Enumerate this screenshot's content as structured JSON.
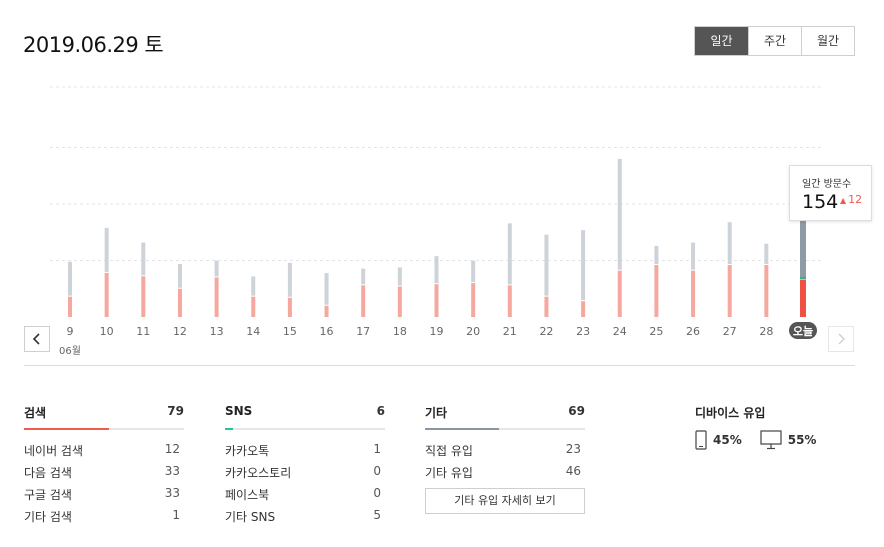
{
  "header": {
    "date": "2019.06.29 토",
    "tabs": [
      "일간",
      "주간",
      "월간"
    ],
    "active_tab": 0
  },
  "chart_data": {
    "type": "bar",
    "month_label": "06월",
    "categories": [
      "9",
      "10",
      "11",
      "12",
      "13",
      "14",
      "15",
      "16",
      "17",
      "18",
      "19",
      "20",
      "21",
      "22",
      "23",
      "24",
      "25",
      "26",
      "27",
      "28",
      "오늘"
    ],
    "series": [
      {
        "values": [
          18,
          39,
          36,
          25,
          35,
          18,
          17,
          10,
          28,
          27,
          29,
          30,
          28,
          18,
          14,
          41,
          46,
          41,
          46,
          46,
          33
        ]
      },
      {
        "values": [
          30,
          39,
          29,
          21,
          14,
          17,
          30,
          28,
          14,
          16,
          24,
          19,
          54,
          54,
          62,
          98,
          16,
          24,
          37,
          18,
          79
        ]
      }
    ],
    "stacked": true,
    "ylim": [
      0,
      160
    ],
    "grid": true,
    "highlight_index": 20,
    "colors": {
      "lower": "#f4a89f",
      "upper": "#cdd3d8",
      "today_lower": "#ef5245",
      "today_upper": "#8e9aa6",
      "today_divider": "#2fb58a"
    }
  },
  "tooltip": {
    "label": "일간 방문수",
    "value": "154",
    "delta": "12",
    "delta_color": "#f05a4f"
  },
  "nav": {
    "prev_icon": "chevron-left-icon",
    "next_icon": "chevron-right-icon"
  },
  "stats": [
    {
      "title": "검색",
      "count": "79",
      "accent": "#ef5b4c",
      "fill_ratio": 0.53,
      "rows": [
        {
          "label": "네이버 검색",
          "count": "12"
        },
        {
          "label": "다음 검색",
          "count": "33"
        },
        {
          "label": "구글 검색",
          "count": "33"
        },
        {
          "label": "기타 검색",
          "count": "1"
        }
      ]
    },
    {
      "title": "SNS",
      "count": "6",
      "accent": "#22c49b",
      "fill_ratio": 0.05,
      "rows": [
        {
          "label": "카카오톡",
          "count": "1"
        },
        {
          "label": "카카오스토리",
          "count": "0"
        },
        {
          "label": "페이스북",
          "count": "0"
        },
        {
          "label": "기타 SNS",
          "count": "5"
        }
      ]
    },
    {
      "title": "기타",
      "count": "69",
      "accent": "#8796a4",
      "fill_ratio": 0.46,
      "rows": [
        {
          "label": "직접 유입",
          "count": "23"
        },
        {
          "label": "기타 유입",
          "count": "46"
        }
      ],
      "button": "기타 유입 자세히 보기"
    }
  ],
  "devices": {
    "title": "디바이스 유입",
    "mobile": "45%",
    "pc": "55%"
  }
}
